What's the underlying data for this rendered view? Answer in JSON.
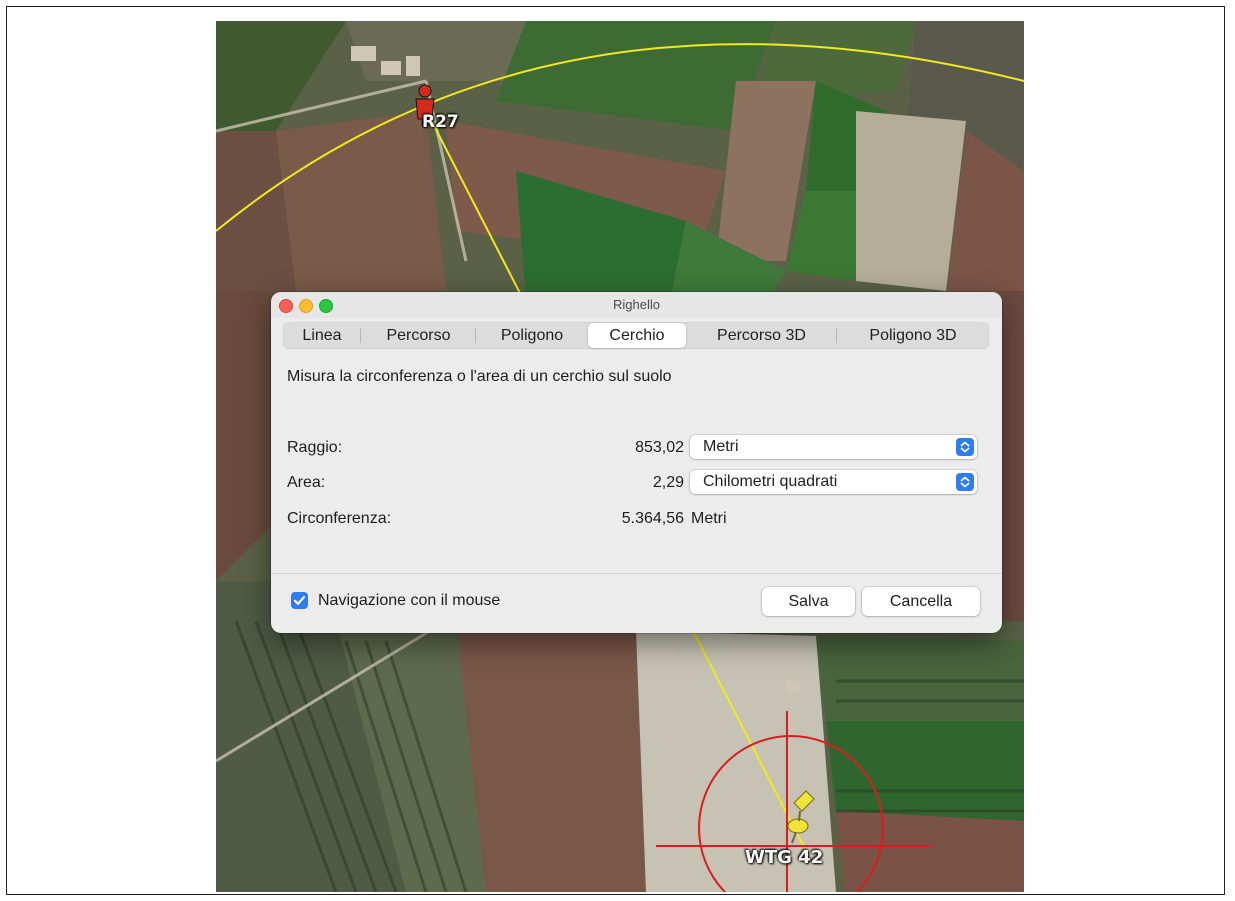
{
  "map": {
    "marker_top_label": "R27",
    "marker_bottom_label": "WTG 42",
    "measure_line_color": "#f2ea1e",
    "target_circle_color": "#d81e1e",
    "person_icon": "person-marker-icon",
    "pin_icon": "pushpin-icon"
  },
  "dialog": {
    "title": "Righello",
    "tabs": [
      {
        "label": "Linea"
      },
      {
        "label": "Percorso"
      },
      {
        "label": "Poligono"
      },
      {
        "label": "Cerchio"
      },
      {
        "label": "Percorso 3D"
      },
      {
        "label": "Poligono 3D"
      }
    ],
    "active_tab": "Cerchio",
    "description": "Misura la circonferenza o l'area di un cerchio sul suolo",
    "radius": {
      "label": "Raggio:",
      "value": "853,02",
      "unit": "Metri"
    },
    "area": {
      "label": "Area:",
      "value": "2,29",
      "unit": "Chilometri quadrati"
    },
    "circumference": {
      "label": "Circonferenza:",
      "value": "5.364,56",
      "unit": "Metri"
    },
    "mouse_nav": {
      "label": "Navigazione con il mouse",
      "checked": true
    },
    "save_label": "Salva",
    "cancel_label": "Cancella",
    "accent_color": "#2f7cf6"
  }
}
